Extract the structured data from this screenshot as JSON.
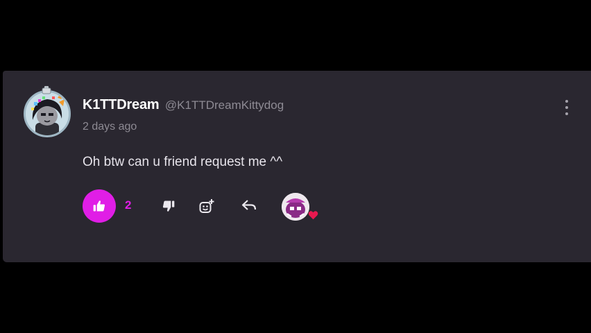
{
  "comment": {
    "author_name": "K1TTDream",
    "author_handle": "@K1TTDreamKittydog",
    "timestamp": "2 days ago",
    "text": "Oh btw can u friend request me ^^",
    "like_count": "2",
    "liked": true
  },
  "icons": {
    "like": "thumbs-up-icon",
    "dislike": "thumbs-down-icon",
    "emoji": "add-reaction-icon",
    "reply": "reply-icon",
    "menu": "more-vertical-icon",
    "creator_heart": "heart-icon"
  },
  "colors": {
    "background": "#000000",
    "card": "#2a2730",
    "accent": "#e01ee6",
    "heart": "#e8194f",
    "text_primary": "#ffffff",
    "text_secondary": "#8e8b94"
  }
}
